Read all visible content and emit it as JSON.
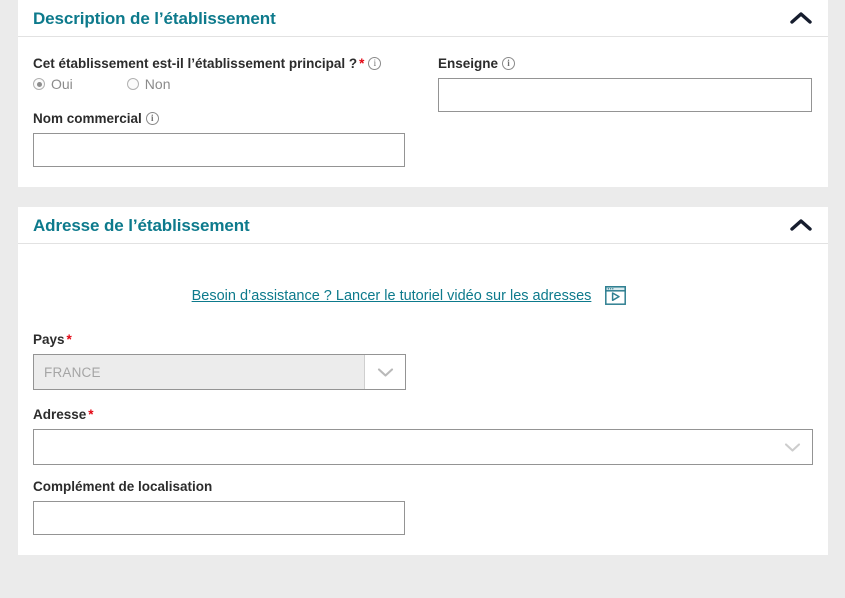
{
  "theme": {
    "accent": "#0d7a8c",
    "required_star": "#e30613",
    "page_background": "#ebebeb",
    "card_background": "#ffffff",
    "input_border": "#949494",
    "disabled_background": "#ececec",
    "disabled_text": "#a5a5a5",
    "chevron_dark": "#161d2e",
    "chevron_light": "#c9c9c9"
  },
  "sections": [
    {
      "id": "description",
      "title": "Description de l’établissement",
      "collapse_icon": "chevron-up-icon",
      "expanded": true,
      "fields": {
        "principal": {
          "label": "Cet établissement est-il l’établissement principal ?",
          "required_marker": "*",
          "info_icon": "info-icon",
          "options": [
            {
              "label": "Oui",
              "selected": true
            },
            {
              "label": "Non",
              "selected": false
            }
          ]
        },
        "nom_commercial": {
          "label": "Nom commercial",
          "info_icon": "info-icon",
          "value": "",
          "placeholder": ""
        },
        "enseigne": {
          "label": "Enseigne",
          "info_icon": "info-icon",
          "value": "",
          "placeholder": ""
        }
      }
    },
    {
      "id": "adresse",
      "title": "Adresse de l’établissement",
      "collapse_icon": "chevron-up-icon",
      "expanded": true,
      "tutorial": {
        "link_text": "Besoin d’assistance ? Lancer le tutoriel vidéo sur les adresses",
        "icon": "video-player-icon"
      },
      "fields": {
        "pays": {
          "label": "Pays",
          "required_marker": "*",
          "value": "FRANCE",
          "disabled": true,
          "dropdown_icon": "chevron-down-icon"
        },
        "adresse": {
          "label": "Adresse",
          "required_marker": "*",
          "value": "",
          "placeholder": "",
          "dropdown_icon": "chevron-down-icon"
        },
        "complement": {
          "label": "Complément de localisation",
          "value": "",
          "placeholder": ""
        }
      }
    }
  ]
}
